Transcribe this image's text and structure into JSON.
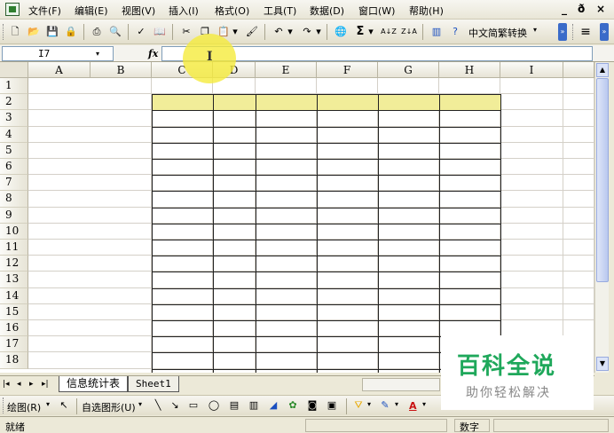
{
  "menubar": {
    "items": [
      "文件(F)",
      "编辑(E)",
      "视图(V)",
      "插入(I)",
      "格式(O)",
      "工具(T)",
      "数据(D)",
      "窗口(W)",
      "帮助(H)"
    ],
    "window_controls": [
      "_",
      "ð",
      "×"
    ]
  },
  "toolbar": {
    "sum_symbol": "Σ",
    "sort_asc": "A↓Z",
    "sort_desc": "Z↓A",
    "convert_label": "中文简繁转换",
    "dropdown_arrow": "▾",
    "align_icon": "≡"
  },
  "formula_bar": {
    "cell_ref": "I7",
    "fx_label": "fx",
    "formula": ""
  },
  "grid": {
    "columns": [
      "A",
      "B",
      "C",
      "D",
      "E",
      "F",
      "G",
      "H",
      "I"
    ],
    "rows": [
      "1",
      "2",
      "3",
      "4",
      "5",
      "6",
      "7",
      "8",
      "9",
      "10",
      "11",
      "12",
      "13",
      "14",
      "15",
      "16",
      "17",
      "18"
    ],
    "highlight_color": "#f1ed99"
  },
  "sheet_tabs": {
    "nav": [
      "|◂",
      "◂",
      "▸",
      "▸|"
    ],
    "tabs": [
      "信息统计表",
      "Sheet1"
    ],
    "active_tab": "信息统计表"
  },
  "draw_toolbar": {
    "draw_label": "绘图(R)",
    "autoshapes_label": "自选图形(U)",
    "font_color_label": "A"
  },
  "status_bar": {
    "status": "就绪",
    "mode": "数字"
  },
  "watermark": {
    "main": "百科全说",
    "sub": "助你轻松解决"
  },
  "colors": {
    "highlight": "#f1ed99",
    "cursor_halo": "#f5eb3c",
    "watermark_green": "#1fa85b"
  }
}
